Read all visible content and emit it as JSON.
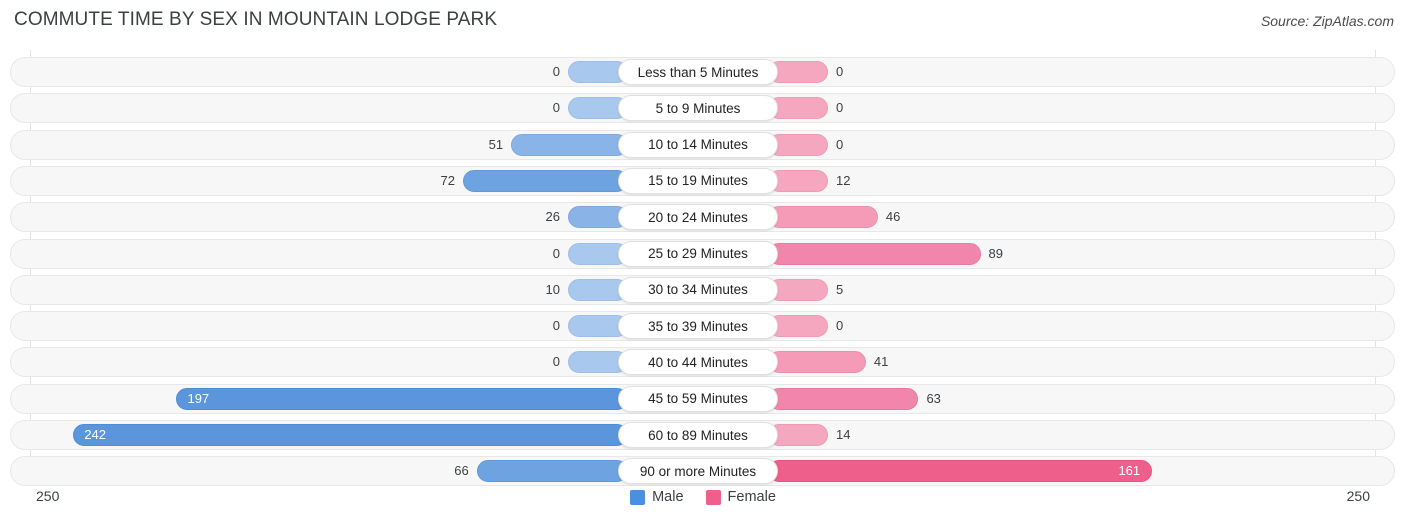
{
  "header": {
    "title": "COMMUTE TIME BY SEX IN MOUNTAIN LODGE PARK",
    "source": "Source: ZipAtlas.com"
  },
  "legend": {
    "items": [
      {
        "label": "Male",
        "color": "#4a90e2"
      },
      {
        "label": "Female",
        "color": "#ef5f8c"
      }
    ]
  },
  "axis": {
    "left_max": "250",
    "right_max": "250"
  },
  "chart_data": {
    "type": "bar",
    "subtype": "diverging-bidirectional-bar",
    "title": "COMMUTE TIME BY SEX IN MOUNTAIN LODGE PARK",
    "source": "Source: ZipAtlas.com",
    "xlabel": "",
    "ylabel": "",
    "xlim": [
      250,
      250
    ],
    "axis_max": 250,
    "grid": false,
    "legend_position": "bottom-center",
    "categories": [
      "Less than 5 Minutes",
      "5 to 9 Minutes",
      "10 to 14 Minutes",
      "15 to 19 Minutes",
      "20 to 24 Minutes",
      "25 to 29 Minutes",
      "30 to 34 Minutes",
      "35 to 39 Minutes",
      "40 to 44 Minutes",
      "45 to 59 Minutes",
      "60 to 89 Minutes",
      "90 or more Minutes"
    ],
    "series": [
      {
        "name": "Male",
        "color": "#4a90e2",
        "direction": "left",
        "values": [
          0,
          0,
          51,
          72,
          26,
          0,
          10,
          0,
          0,
          197,
          242,
          66
        ]
      },
      {
        "name": "Female",
        "color": "#ef5f8c",
        "direction": "right",
        "values": [
          0,
          0,
          0,
          12,
          46,
          89,
          5,
          0,
          41,
          63,
          14,
          161
        ]
      }
    ]
  },
  "rows": [
    {
      "label": "Less than 5 Minutes",
      "male": "0",
      "female": "0"
    },
    {
      "label": "5 to 9 Minutes",
      "male": "0",
      "female": "0"
    },
    {
      "label": "10 to 14 Minutes",
      "male": "51",
      "female": "0"
    },
    {
      "label": "15 to 19 Minutes",
      "male": "72",
      "female": "12"
    },
    {
      "label": "20 to 24 Minutes",
      "male": "26",
      "female": "46"
    },
    {
      "label": "25 to 29 Minutes",
      "male": "0",
      "female": "89"
    },
    {
      "label": "30 to 34 Minutes",
      "male": "10",
      "female": "5"
    },
    {
      "label": "35 to 39 Minutes",
      "male": "0",
      "female": "0"
    },
    {
      "label": "40 to 44 Minutes",
      "male": "0",
      "female": "41"
    },
    {
      "label": "45 to 59 Minutes",
      "male": "197",
      "female": "63"
    },
    {
      "label": "60 to 89 Minutes",
      "male": "242",
      "female": "14"
    },
    {
      "label": "90 or more Minutes",
      "male": "66",
      "female": "161"
    }
  ]
}
